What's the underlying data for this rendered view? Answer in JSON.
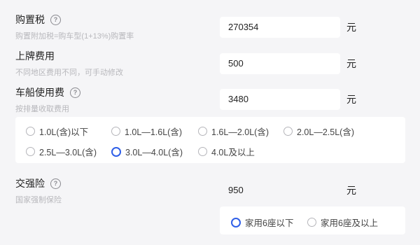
{
  "purchase_tax": {
    "title": "购置税",
    "subtitle": "购置附加税=购车型(1+13%)购置率",
    "value": "270354",
    "unit": "元"
  },
  "plate_fee": {
    "title": "上牌费用",
    "subtitle": "不同地区费用不同，可手动修改",
    "value": "500",
    "unit": "元"
  },
  "vessel_tax": {
    "title": "车船使用费",
    "subtitle": "按排量收取费用",
    "value": "3480",
    "unit": "元",
    "options": [
      "1.0L(含)以下",
      "1.0L—1.6L(含)",
      "1.6L—2.0L(含)",
      "2.0L—2.5L(含)",
      "2.5L—3.0L(含)",
      "3.0L—4.0L(含)",
      "4.0L及以上"
    ],
    "selected_index": 5
  },
  "compulsory_insurance": {
    "title": "交强险",
    "subtitle": "国家强制保险",
    "value": "950",
    "unit": "元",
    "options": [
      "家用6座以下",
      "家用6座及以上"
    ],
    "selected_index": 0
  },
  "help_glyph": "?",
  "colors": {
    "accent": "#2f5fe8",
    "panel": "#ffffff",
    "background": "#f5f5f7",
    "subtext": "#b8b8bc"
  },
  "icons": {
    "help": "question-circle-icon",
    "radio": "radio-circle-icon"
  }
}
